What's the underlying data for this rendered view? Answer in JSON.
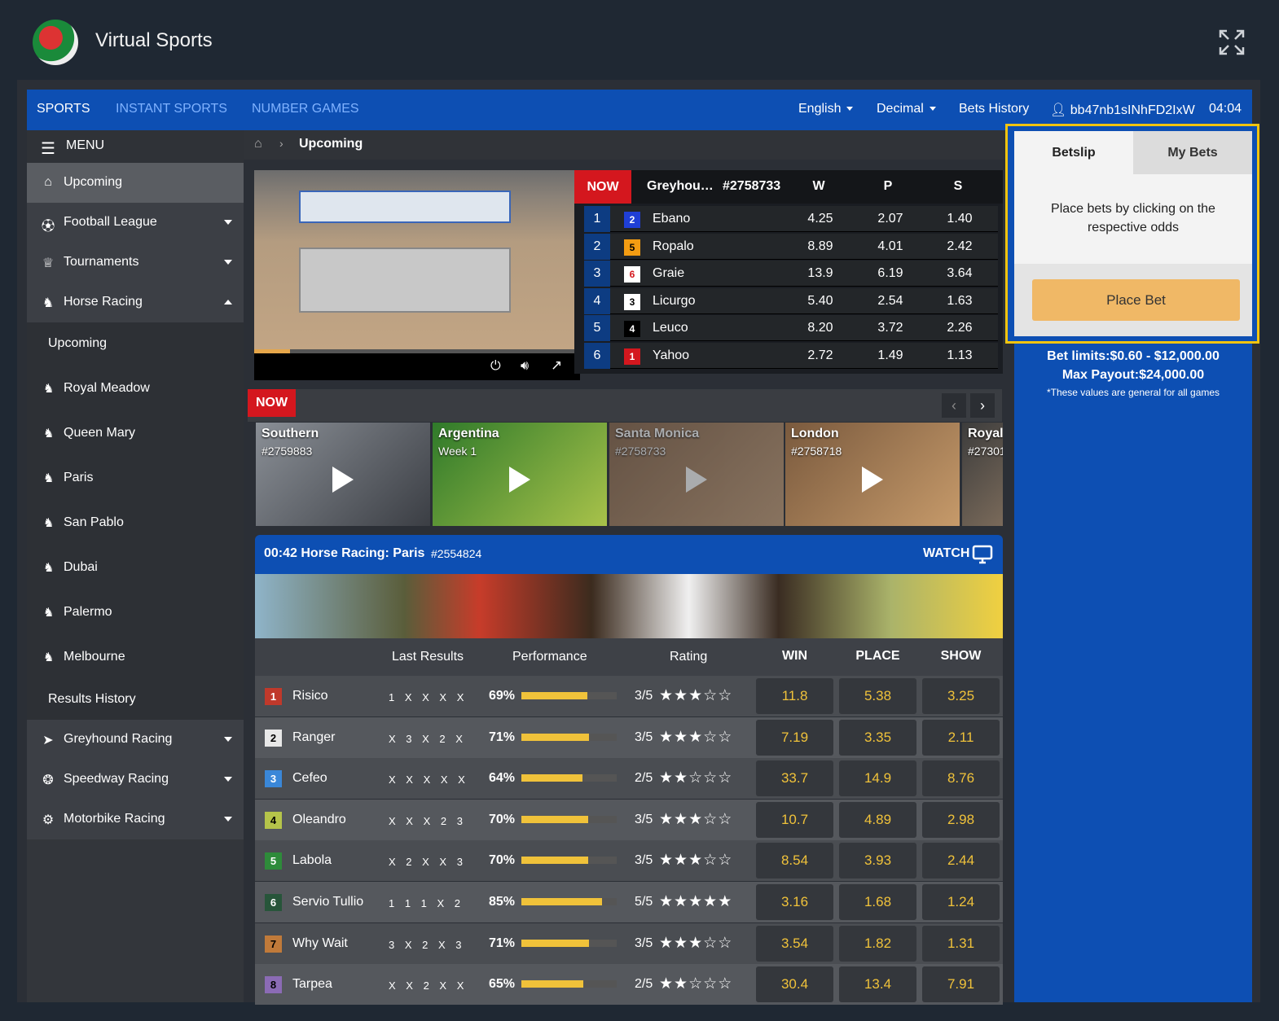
{
  "app": {
    "title": "Virtual Sports"
  },
  "topnav": {
    "tabs": [
      "SPORTS",
      "INSTANT SPORTS",
      "NUMBER GAMES"
    ],
    "language": "English",
    "odds_format": "Decimal",
    "bets_history": "Bets History",
    "user": "bb47nb1sINhFD2IxW",
    "time": "04:04"
  },
  "sidebar": {
    "menu_label": "MENU",
    "items": [
      {
        "label": "Upcoming",
        "icon": "home-icon"
      },
      {
        "label": "Football League",
        "icon": "soccer-ball-icon"
      },
      {
        "label": "Tournaments",
        "icon": "trophy-icon"
      },
      {
        "label": "Horse Racing",
        "icon": "horse-icon"
      }
    ],
    "horse_sub": [
      "Upcoming",
      "Royal Meadow",
      "Queen Mary",
      "Paris",
      "San Pablo",
      "Dubai",
      "Palermo",
      "Melbourne",
      "Results History"
    ],
    "bottom_items": [
      {
        "label": "Greyhound Racing",
        "icon": "greyhound-icon"
      },
      {
        "label": "Speedway Racing",
        "icon": "speedway-icon"
      },
      {
        "label": "Motorbike Racing",
        "icon": "motorbike-icon"
      }
    ]
  },
  "breadcrumb": {
    "current": "Upcoming"
  },
  "live_race": {
    "now_label": "NOW",
    "title": "Greyhou…",
    "id": "#2758733",
    "col_w": "W",
    "col_p": "P",
    "col_s": "S",
    "runners": [
      {
        "pos": "1",
        "num": "2",
        "name": "Ebano",
        "w": "4.25",
        "p": "2.07",
        "s": "1.40",
        "bg": "#1f3fd6",
        "fg": "#ffffff"
      },
      {
        "pos": "2",
        "num": "5",
        "name": "Ropalo",
        "w": "8.89",
        "p": "4.01",
        "s": "2.42",
        "bg": "#f39c12",
        "fg": "#000000"
      },
      {
        "pos": "3",
        "num": "6",
        "name": "Graie",
        "w": "13.9",
        "p": "6.19",
        "s": "3.64",
        "bg": "#ffffff",
        "fg": "#d4171e"
      },
      {
        "pos": "4",
        "num": "3",
        "name": "Licurgo",
        "w": "5.40",
        "p": "2.54",
        "s": "1.63",
        "bg": "#ffffff",
        "fg": "#000000"
      },
      {
        "pos": "5",
        "num": "4",
        "name": "Leuco",
        "w": "8.20",
        "p": "3.72",
        "s": "2.26",
        "bg": "#000000",
        "fg": "#ffffff"
      },
      {
        "pos": "6",
        "num": "1",
        "name": "Yahoo",
        "w": "2.72",
        "p": "1.49",
        "s": "1.13",
        "bg": "#d4171e",
        "fg": "#ffffff"
      }
    ]
  },
  "carousel": {
    "now_label": "NOW",
    "tiles": [
      {
        "title": "Southern",
        "sub": "#2759883",
        "colors": [
          "#8a8f96",
          "#3b3e44"
        ]
      },
      {
        "title": "Argentina",
        "sub": "Week 1",
        "colors": [
          "#2f7a2a",
          "#a8c24a"
        ]
      },
      {
        "title": "Santa Monica",
        "sub": "#2758733",
        "colors": [
          "#8b6a4e",
          "#c6a07a"
        ]
      },
      {
        "title": "London",
        "sub": "#2758718",
        "colors": [
          "#7a5a3e",
          "#c69a6a"
        ]
      },
      {
        "title": "Royal",
        "sub": "#27301",
        "colors": [
          "#3c3c3c",
          "#7a6a5a"
        ]
      }
    ]
  },
  "event": {
    "title": "00:42 Horse Racing: Paris",
    "id": "#2554824",
    "watch": "WATCH",
    "headers": {
      "last": "Last Results",
      "perf": "Performance",
      "rating": "Rating",
      "win": "WIN",
      "place": "PLACE",
      "show": "SHOW"
    },
    "runners": [
      {
        "num": "1",
        "name": "Risico",
        "last": "1 X X X X",
        "perf": "69%",
        "perf_value": 69,
        "rating": "3/5",
        "stars": 3,
        "win": "11.8",
        "place": "5.38",
        "show": "3.25",
        "badge_bg": "#c0392b",
        "badge_fg": "#ffffff"
      },
      {
        "num": "2",
        "name": "Ranger",
        "last": "X 3 X 2 X",
        "perf": "71%",
        "perf_value": 71,
        "rating": "3/5",
        "stars": 3,
        "win": "7.19",
        "place": "3.35",
        "show": "2.11",
        "badge_bg": "#e8e8e8",
        "badge_fg": "#000000"
      },
      {
        "num": "3",
        "name": "Cefeo",
        "last": "X X X X X",
        "perf": "64%",
        "perf_value": 64,
        "rating": "2/5",
        "stars": 2,
        "win": "33.7",
        "place": "14.9",
        "show": "8.76",
        "badge_bg": "#3a87d8",
        "badge_fg": "#ffffff"
      },
      {
        "num": "4",
        "name": "Oleandro",
        "last": "X X X 2 3",
        "perf": "70%",
        "perf_value": 70,
        "rating": "3/5",
        "stars": 3,
        "win": "10.7",
        "place": "4.89",
        "show": "2.98",
        "badge_bg": "#b5c44a",
        "badge_fg": "#000000"
      },
      {
        "num": "5",
        "name": "Labola",
        "last": "X 2 X X 3",
        "perf": "70%",
        "perf_value": 70,
        "rating": "3/5",
        "stars": 3,
        "win": "8.54",
        "place": "3.93",
        "show": "2.44",
        "badge_bg": "#2e8b3a",
        "badge_fg": "#ffffff"
      },
      {
        "num": "6",
        "name": "Servio Tullio",
        "last": "1 1 1 X 2",
        "perf": "85%",
        "perf_value": 85,
        "rating": "5/5",
        "stars": 5,
        "win": "3.16",
        "place": "1.68",
        "show": "1.24",
        "badge_bg": "#27553a",
        "badge_fg": "#ffffff"
      },
      {
        "num": "7",
        "name": "Why Wait",
        "last": "3 X 2 X 3",
        "perf": "71%",
        "perf_value": 71,
        "rating": "3/5",
        "stars": 3,
        "win": "3.54",
        "place": "1.82",
        "show": "1.31",
        "badge_bg": "#c07a3a",
        "badge_fg": "#000000"
      },
      {
        "num": "8",
        "name": "Tarpea",
        "last": "X X 2 X X",
        "perf": "65%",
        "perf_value": 65,
        "rating": "2/5",
        "stars": 2,
        "win": "30.4",
        "place": "13.4",
        "show": "7.91",
        "badge_bg": "#8b6bb5",
        "badge_fg": "#000000"
      }
    ]
  },
  "betslip": {
    "tab_betslip": "Betslip",
    "tab_mybets": "My Bets",
    "message": "Place bets by clicking on the respective odds",
    "place_bet": "Place Bet",
    "limits": "Bet limits:$0.60 - $12,000.00",
    "max_payout": "Max Payout:$24,000.00",
    "note": "*These values are general for all games"
  },
  "colors": {
    "accent": "#0d4fb3",
    "highlight": "#f1c40f",
    "odds": "#f0c23a",
    "now": "#d4171e"
  }
}
